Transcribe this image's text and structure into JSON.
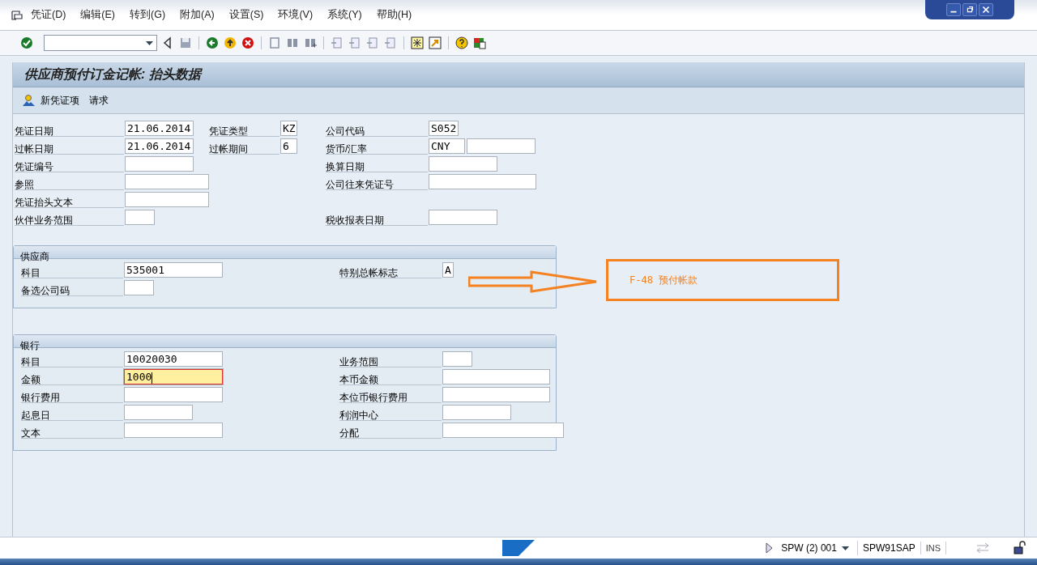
{
  "menu": [
    "凭证(D)",
    "编辑(E)",
    "转到(G)",
    "附加(A)",
    "设置(S)",
    "环境(V)",
    "系统(Y)",
    "帮助(H)"
  ],
  "title": "供应商预付订金记帐: 抬头数据",
  "app_toolbar": [
    "新凭证项",
    "请求"
  ],
  "header": {
    "rows": [
      {
        "main": {
          "label": "凭证日期",
          "value": "21.06.2014"
        },
        "middle": {
          "label": "凭证类型",
          "value": "KZ"
        },
        "right": {
          "label": "公司代码",
          "value": "S052"
        }
      },
      {
        "main": {
          "label": "过帐日期",
          "value": "21.06.2014"
        },
        "middle": {
          "label": "过帐期间",
          "value": "6"
        },
        "right": {
          "label": "货币/汇率",
          "value": "CNY"
        }
      },
      {
        "main": {
          "label": "凭证编号"
        },
        "right": {
          "label": "换算日期"
        }
      },
      {
        "main": {
          "label": "参照"
        },
        "right": {
          "label": "公司往来凭证号"
        }
      },
      {
        "main": {
          "label": "凭证抬头文本"
        }
      },
      {
        "main": {
          "label": "伙伴业务范围"
        },
        "right": {
          "label": "税收报表日期"
        }
      }
    ]
  },
  "vendor": {
    "title": "供应商",
    "rows": [
      {
        "main": {
          "label": "科目",
          "value": "535001"
        },
        "right": {
          "label": "特别总帐标志",
          "value": "A"
        }
      },
      {
        "main": {
          "label": "备选公司码"
        }
      }
    ]
  },
  "bank": {
    "title": "银行",
    "rows": [
      {
        "main": {
          "label": "科目",
          "value": "10020030"
        },
        "right": {
          "label": "业务范围"
        }
      },
      {
        "main": {
          "label": "金额",
          "value": "1000",
          "focused": true
        },
        "right": {
          "label": "本币金额"
        }
      },
      {
        "main": {
          "label": "银行费用"
        },
        "right": {
          "label": "本位币银行费用"
        }
      },
      {
        "main": {
          "label": "起息日"
        },
        "right": {
          "label": "利润中心"
        }
      },
      {
        "main": {
          "label": "文本"
        },
        "right": {
          "label": "分配"
        }
      }
    ]
  },
  "annotation": {
    "text": "F-48 预付帐款"
  },
  "status_bar": {
    "system": "SPW (2) 001",
    "server": "SPW91SAP",
    "mode": "INS"
  }
}
